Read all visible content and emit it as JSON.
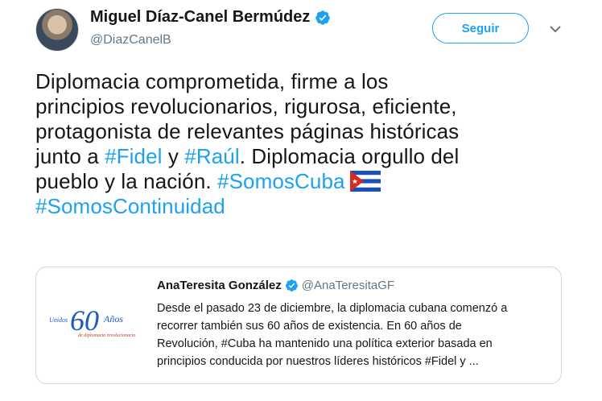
{
  "author": {
    "name": "Miguel Díaz-Canel Bermúdez",
    "handle": "@DiazCanelB"
  },
  "follow_button": {
    "label": "Seguir"
  },
  "tweet": {
    "line1": "Diplomacia comprometida, firme a los",
    "line2": "principios revolucionarios,  rigurosa, eficiente,",
    "line3": "protagonista de relevantes páginas históricas",
    "line4_a": "junto a ",
    "line4_tag1": "#Fidel",
    "line4_b": " y ",
    "line4_tag2": "#Raúl",
    "line4_c": ". Diplomacia orgullo del",
    "line5_a": "pueblo y la nación. ",
    "line5_tag": "#SomosCuba",
    "line6_tag": "#SomosContinuidad"
  },
  "quoted": {
    "name": "AnaTeresita González",
    "handle": "@AnaTeresitaGF",
    "line1": "Desde el pasado 23 de diciembre, la diplomacia cubana comenzó a",
    "line2": "recorrer también sus 60 años de existencia. En 60 años de",
    "line3": "Revolución, #Cuba ha mantenido una política exterior basada en",
    "line4": "principios conducida por nuestros líderes históricos #Fidel y ...",
    "logo": {
      "prefix": "Unidos",
      "number": "60",
      "word": "Años",
      "subtitle": "de diplomacia revolucionaria"
    }
  },
  "colors": {
    "accent": "#1da1f2",
    "text": "#14171a",
    "muted": "#657786",
    "border": "#ccd6dd"
  },
  "icons": [
    "verified-badge-icon",
    "chevron-down-icon",
    "cuba-flag-emoji"
  ]
}
